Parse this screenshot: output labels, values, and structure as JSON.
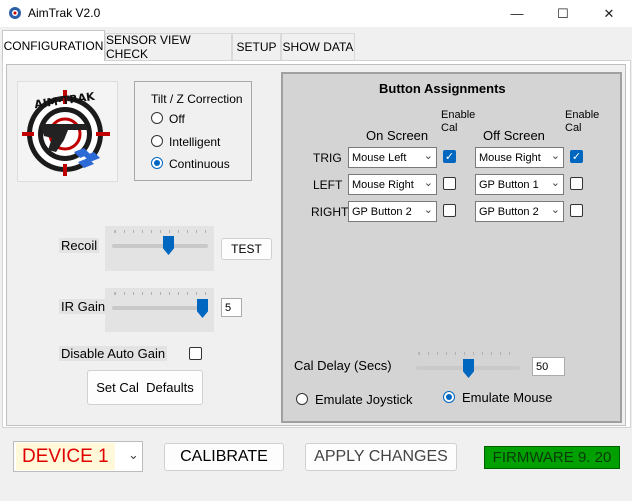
{
  "window": {
    "title": "AimTrak V2.0",
    "minimize_glyph": "—",
    "maximize_glyph": "☐",
    "close_glyph": "✕"
  },
  "tabs": [
    {
      "label": "CONFIGURATION",
      "active": true
    },
    {
      "label": "SENSOR VIEW CHECK",
      "active": false
    },
    {
      "label": "SETUP",
      "active": false
    },
    {
      "label": "SHOW DATA",
      "active": false
    }
  ],
  "tilt": {
    "title": "Tilt / Z Correction",
    "options": [
      "Off",
      "Intelligent",
      "Continuous"
    ],
    "selected": "Continuous"
  },
  "recoil": {
    "label": "Recoil",
    "level_fraction": 0.6,
    "test_label": "TEST"
  },
  "ir_gain": {
    "label": "IR Gain",
    "value": "5",
    "level_fraction": 1.0
  },
  "disable_auto_gain": {
    "label": "Disable Auto Gain",
    "checked": false
  },
  "set_cal_defaults_label": "Set Cal  Defaults",
  "assignments": {
    "title": "Button Assignments",
    "on_screen_header": "On Screen",
    "off_screen_header": "Off Screen",
    "enable_cal_header": "Enable Cal",
    "rows": [
      {
        "label": "TRIG",
        "on_screen": "Mouse Left",
        "on_cal": true,
        "off_screen": "Mouse Right",
        "off_cal": true
      },
      {
        "label": "LEFT",
        "on_screen": "Mouse Right",
        "on_cal": false,
        "off_screen": "GP Button 1",
        "off_cal": false
      },
      {
        "label": "RIGHT",
        "on_screen": "GP Button 2",
        "on_cal": false,
        "off_screen": "GP Button 2",
        "off_cal": false
      }
    ],
    "cal_delay": {
      "label": "Cal Delay (Secs)",
      "value": "50",
      "level_fraction": 0.5
    },
    "emulate_joystick": {
      "label": "Emulate Joystick",
      "selected": false
    },
    "emulate_mouse": {
      "label": "Emulate Mouse",
      "selected": true
    }
  },
  "bottom": {
    "device": "DEVICE 1",
    "calibrate_label": "CALIBRATE",
    "apply_label": "APPLY CHANGES",
    "firmware": "FIRMWARE 9. 20"
  },
  "colors": {
    "accent": "#0067c0",
    "firmware_bg": "#00a000",
    "device_text": "#e00000",
    "device_bg": "#fff9d9"
  },
  "icons": {
    "app": "aimtrak-app-icon",
    "logo": "aim-trak-logo",
    "dropdown": "chevron-down-icon"
  }
}
